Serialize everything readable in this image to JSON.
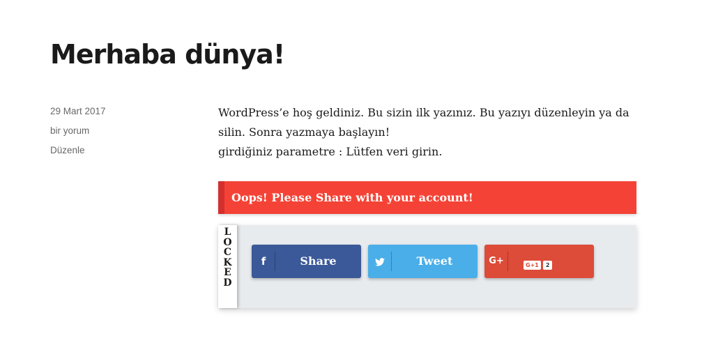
{
  "post": {
    "title": "Merhaba dünya!",
    "meta": {
      "date": "29 Mart 2017",
      "comments": "bir yorum",
      "edit": "Düzenle"
    },
    "content": {
      "paragraph1": "WordPress’e hoş geldiniz. Bu sizin ilk yazınız. Bu yazıyı düzenleyin ya da silin. Sonra yazmaya başlayın!",
      "paragraph2": "girdiğiniz parametre : Lütfen veri girin."
    }
  },
  "alert": {
    "message": "Oops! Please Share with your account!",
    "color": "#f44336"
  },
  "locker": {
    "letters": [
      "L",
      "O",
      "C",
      "K",
      "E",
      "D"
    ],
    "buttons": {
      "facebook": {
        "label": "Share",
        "icon": "facebook-icon",
        "color": "#3b5998"
      },
      "twitter": {
        "label": "Tweet",
        "icon": "twitter-icon",
        "color": "#4aaee8"
      },
      "googleplus": {
        "icon": "google-plus-icon",
        "badge": "G+1",
        "count": "2",
        "color": "#dd4b39"
      }
    }
  }
}
